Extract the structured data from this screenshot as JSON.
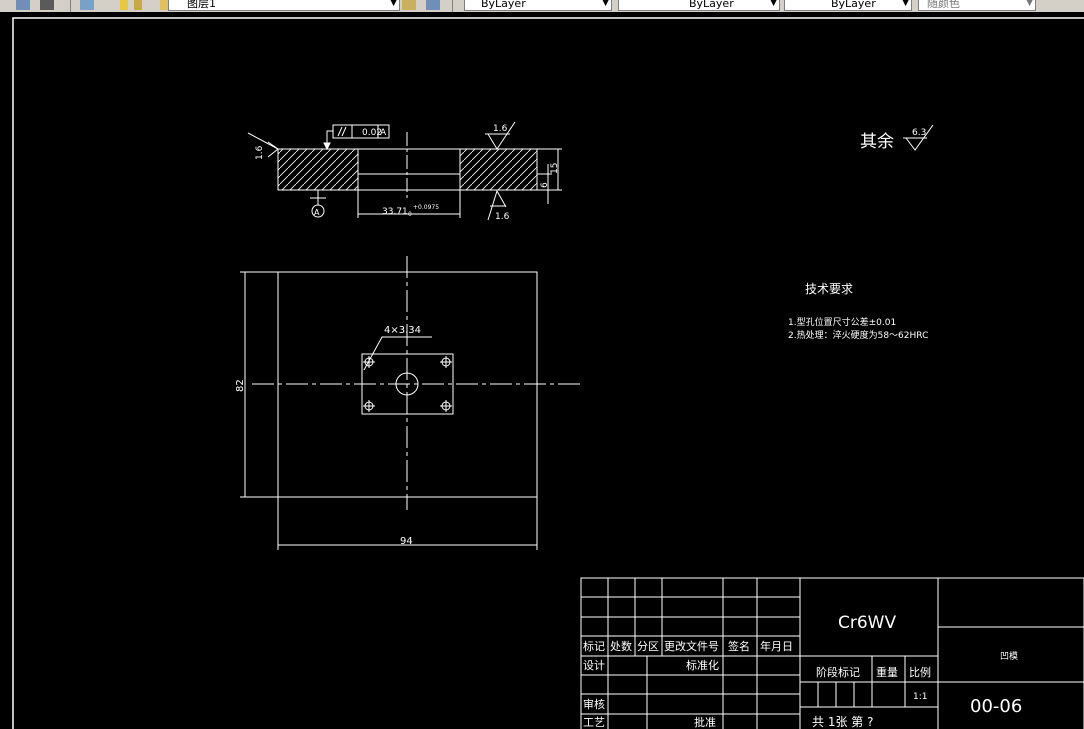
{
  "toolbar": {
    "layer_name": "图层1",
    "color": "ByLayer",
    "linetype": "ByLayer",
    "lineweight": "ByLayer",
    "plotstyle": "随颜色"
  },
  "drawing": {
    "roughness_rest_label": "其余",
    "roughness_rest_value": "6.3",
    "section": {
      "flatness_value": "0.02",
      "datum_letter": "A",
      "roughness_top": "1.6",
      "roughness_left": "1.6",
      "roughness_bottom": "1.6",
      "dim_bore": "33.71",
      "dim_bore_tol_upper": "+0.0975",
      "dim_bore_tol_lower": "0",
      "dim_height_total": "15",
      "dim_height_step": "6"
    },
    "plan": {
      "hole_callout": "4×3.34",
      "dim_height": "82",
      "dim_width": "94"
    },
    "tech_req": {
      "title": "技术要求",
      "items": [
        "1.型孔位置尺寸公差±0.01",
        "2.热处理：淬火硬度为58～62HRC"
      ]
    },
    "title_block": {
      "material": "Cr6WV",
      "part_name": "凹模",
      "drawing_number": "00-06",
      "headers": [
        "标记",
        "处数",
        "分区",
        "更改文件号",
        "签名",
        "年月日"
      ],
      "design": "设计",
      "standardization": "标准化",
      "stage_mark": "阶段标记",
      "weight": "重量",
      "scale_label": "比例",
      "scale_value": "1:1",
      "review": "审核",
      "process": "工艺",
      "approve": "批准",
      "sheets": "共 1张 第 ?"
    }
  }
}
